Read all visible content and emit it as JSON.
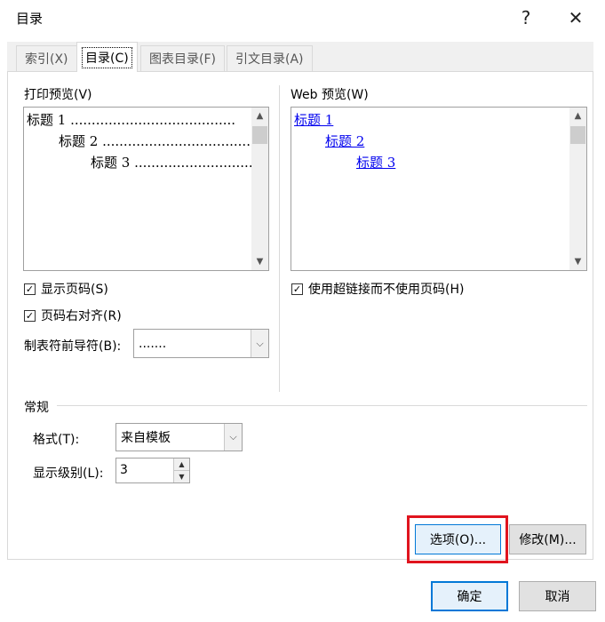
{
  "dialog": {
    "title": "目录",
    "help_label": "?",
    "close_label": "✕"
  },
  "tabs": [
    {
      "label": "索引(X)",
      "active": false
    },
    {
      "label": "目录(C)",
      "active": true
    },
    {
      "label": "图表目录(F)",
      "active": false
    },
    {
      "label": "引文目录(A)",
      "active": false
    }
  ],
  "print_preview": {
    "label": "打印预览(V)",
    "lines": [
      "标题 1 .......................................",
      "标题 2 .....................................",
      "标题 3 ...................................."
    ]
  },
  "web_preview": {
    "label": "Web 预览(W)",
    "lines": [
      "标题 1",
      "标题 2",
      "标题 3"
    ]
  },
  "options": {
    "show_page_numbers": {
      "label": "显示页码(S)",
      "checked": true
    },
    "right_align": {
      "label": "页码右对齐(R)",
      "checked": true
    },
    "use_hyperlinks": {
      "label": "使用超链接而不使用页码(H)",
      "checked": true
    },
    "tab_leader": {
      "label": "制表符前导符(B):",
      "value": "......."
    }
  },
  "general": {
    "label": "常规",
    "format": {
      "label": "格式(T):",
      "value": "来自模板"
    },
    "levels": {
      "label": "显示级别(L):",
      "value": "3"
    }
  },
  "buttons": {
    "options": "选项(O)...",
    "modify": "修改(M)...",
    "ok": "确定",
    "cancel": "取消"
  },
  "icons": {
    "check": "✓",
    "arrow_up": "▲",
    "arrow_down": "▼",
    "chevron_down": "⌵"
  },
  "colors": {
    "accent": "#0078d7",
    "highlight": "#e0141e",
    "link": "#0000ee"
  }
}
